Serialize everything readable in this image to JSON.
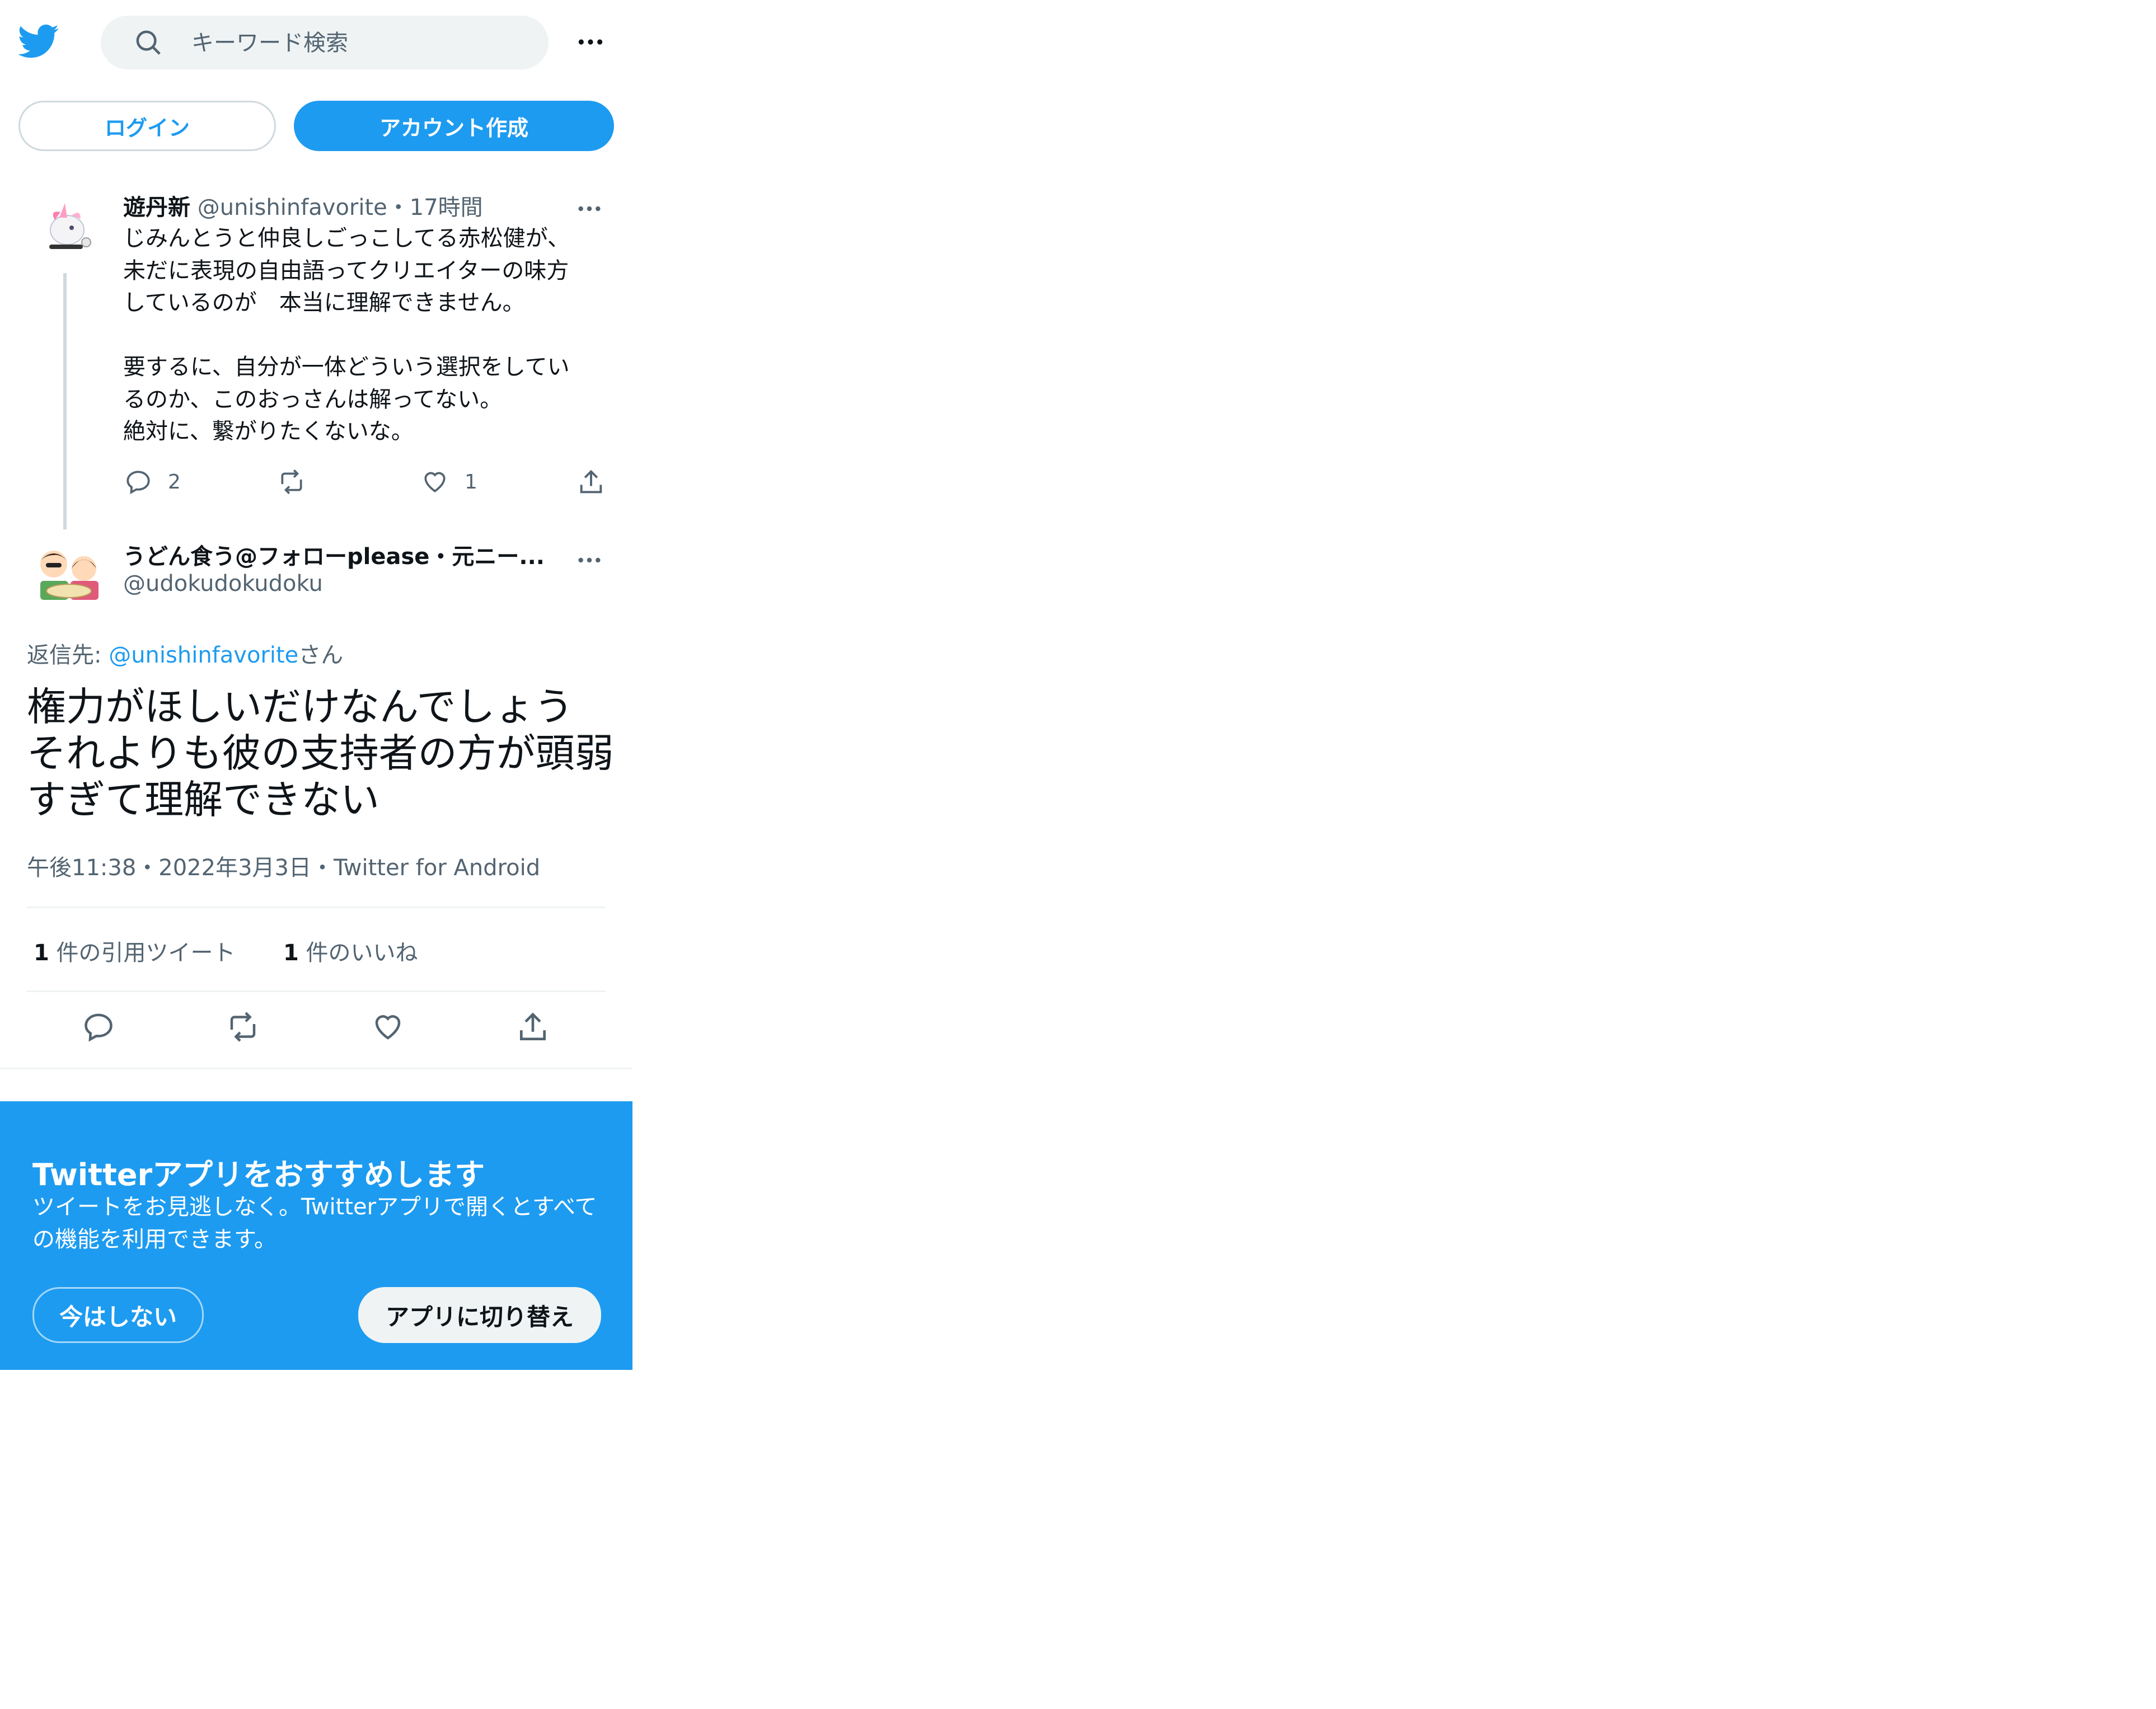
{
  "header": {
    "search_placeholder": "キーワード検索"
  },
  "auth": {
    "login_label": "ログイン",
    "signup_label": "アカウント作成"
  },
  "parent_tweet": {
    "name": "遊丹新",
    "handle": "@unishinfavorite",
    "separator": "・",
    "time": "17時間",
    "text": "じみんとうと仲良しごっこしてる赤松健が、\n未だに表現の自由語ってクリエイターの味方\nしているのが　本当に理解できません。\n\n要するに、自分が一体どういう選択をしてい\nるのか、このおっさんは解ってない。\n絶対に、繋がりたくないな。",
    "reply_count": "2",
    "like_count": "1"
  },
  "focused_tweet": {
    "name": "うどん食う@フォローplease・元ニー...",
    "handle": "@udokudokudoku",
    "reply_prefix": "返信先: ",
    "reply_to": "@unishinfavorite",
    "reply_suffix": "さん",
    "text": "権力がほしいだけなんでしょう\nそれよりも彼の支持者の方が頭弱\nすぎて理解できない",
    "time": "午後11:38",
    "sep": "・",
    "date": "2022年3月3日",
    "source": "Twitter for Android",
    "quote_count": "1",
    "quote_label": " 件の引用ツイート",
    "like_count": "1",
    "like_label": " 件のいいね"
  },
  "app_prompt": {
    "title": "Twitterアプリをおすすめします",
    "body": "ツイートをお見逃しなく。Twitterアプリで開くとすべての機能を利用できます。",
    "not_now_label": "今はしない",
    "switch_label": "アプリに切り替え"
  },
  "colors": {
    "brand": "#1d9bf0",
    "muted": "#536471"
  }
}
